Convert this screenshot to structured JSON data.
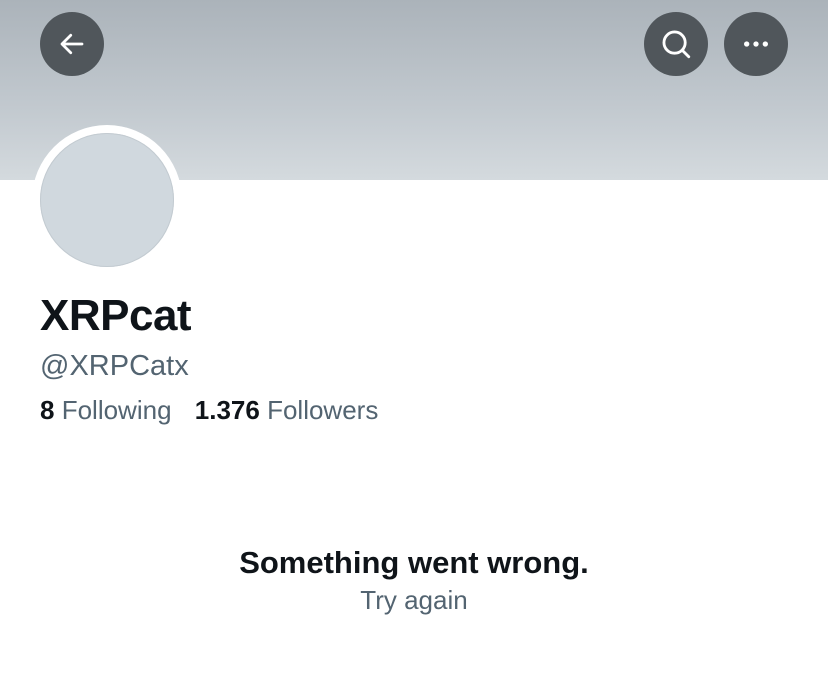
{
  "header": {
    "back_icon": "arrow-left-icon",
    "search_icon": "search-icon",
    "more_icon": "more-horizontal-icon",
    "banner_color": "#c2c9cf",
    "button_color": "#50565b"
  },
  "profile": {
    "display_name": "XRPcat",
    "handle": "@XRPCatx",
    "avatar_color": "#d0d8de",
    "following_count": "8",
    "following_label": "Following",
    "followers_count": "1.376",
    "followers_label": "Followers"
  },
  "error": {
    "message": "Something went wrong.",
    "retry_label": "Try again"
  }
}
